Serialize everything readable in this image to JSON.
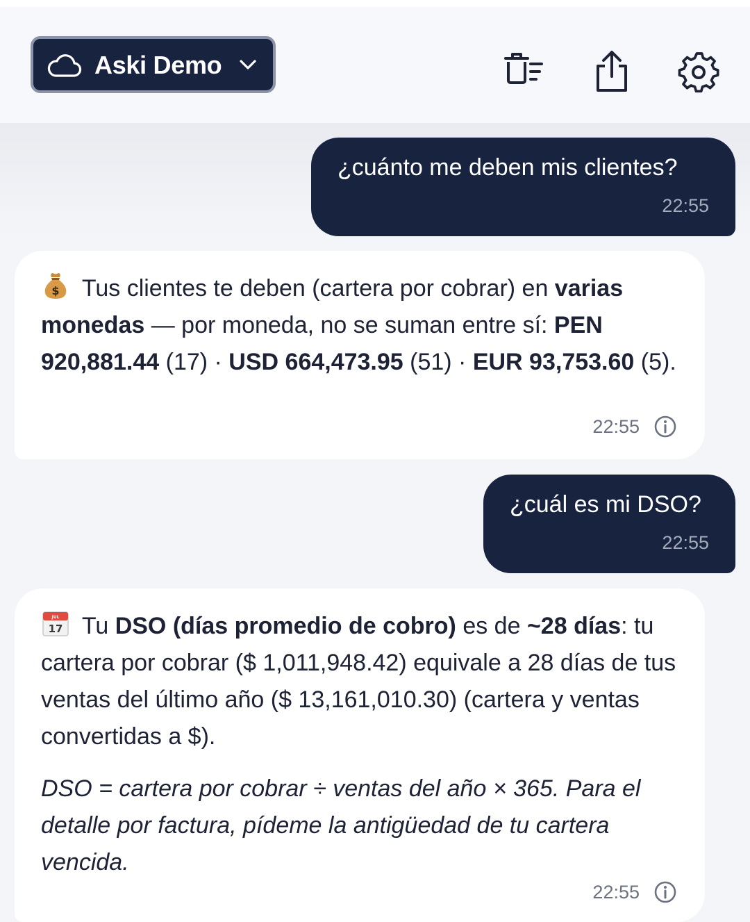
{
  "header": {
    "workspace_label": "Aski Demo",
    "icons": [
      "cloud-icon",
      "chevron-down-icon",
      "clear-chat-icon",
      "share-icon",
      "gear-icon"
    ]
  },
  "messages": [
    {
      "role": "user",
      "text": "¿cuánto me deben mis clientes?",
      "time": "22:55"
    },
    {
      "role": "assistant",
      "icon": "money-bag-icon",
      "p1": " Tus clientes te deben (cartera por cobrar) en ",
      "b1": "varias monedas",
      "p2": " — por moneda, no se suman entre sí: ",
      "b2": "PEN 920,881.44",
      "p3": " (17) · ",
      "b3": "USD 664,473.95",
      "p4": " (51) · ",
      "b4": "EUR 93,753.60",
      "p5": " (5).",
      "time": "22:55"
    },
    {
      "role": "user",
      "text": "¿cuál es mi DSO?",
      "time": "22:55"
    },
    {
      "role": "assistant",
      "icon": "calendar-icon",
      "p1": " Tu ",
      "b1": "DSO (días promedio de cobro)",
      "p2": " es de ",
      "b2": "~28 días",
      "p3": ": tu cartera por cobrar ($ 1,011,948.42) equivale a 28 días de tus ventas del último año ($ 13,161,010.30) (cartera y ventas convertidas a $).",
      "note": "DSO = cartera por cobrar ÷ ventas del año × 365. Para el detalle por factura, pídeme la antigüedad de tu cartera vencida.",
      "time": "22:55"
    }
  ]
}
